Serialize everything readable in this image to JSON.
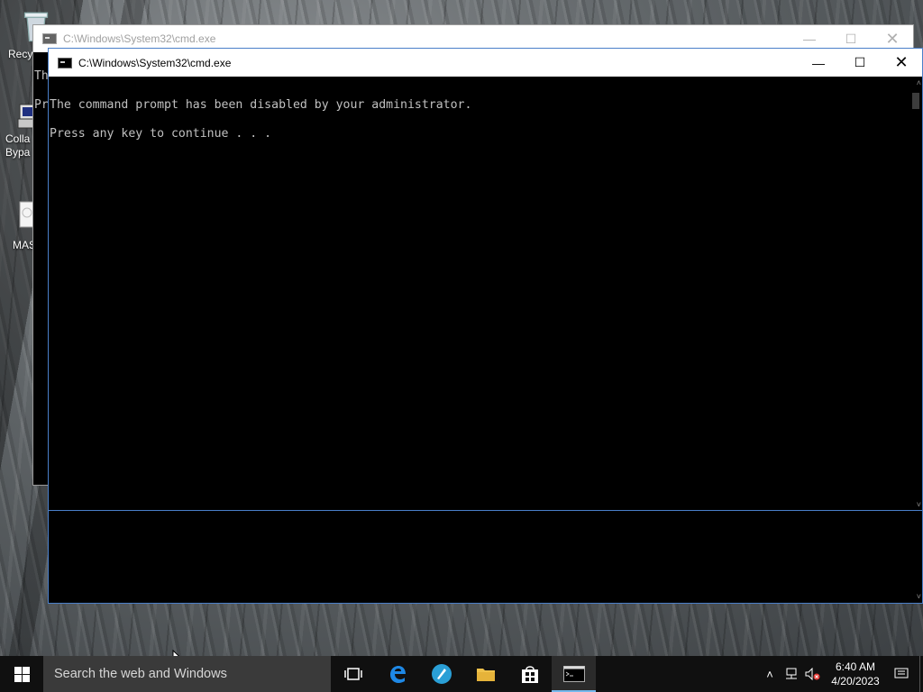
{
  "desktop": {
    "icons": [
      {
        "label": "Recy",
        "icon": "recycle-bin-icon"
      },
      {
        "label": "Colla Bypa",
        "icon": "app-shortcut-icon"
      },
      {
        "label": "MAS",
        "icon": "document-icon"
      }
    ]
  },
  "back_window": {
    "title": "C:\\Windows\\System32\\cmd.exe",
    "partial_lines": [
      "Th",
      "Pr"
    ]
  },
  "front_window": {
    "title": "C:\\Windows\\System32\\cmd.exe",
    "console_lines": [
      "The command prompt has been disabled by your administrator.",
      "Press any key to continue . . ."
    ],
    "controls": {
      "minimize": "minimize-icon",
      "maximize": "maximize-icon",
      "close": "close-icon"
    }
  },
  "taskbar": {
    "search_placeholder": "Search the web and Windows",
    "pinned": [
      "task-view-icon",
      "edge-icon",
      "app-icon",
      "file-explorer-icon",
      "store-icon",
      "cmd-icon"
    ],
    "tray": {
      "time": "6:40 AM",
      "date": "4/20/2023",
      "icons": [
        "chevron-up-icon",
        "network-icon",
        "volume-muted-icon",
        "notifications-icon"
      ]
    }
  },
  "colors": {
    "console_bg": "#000000",
    "console_fg": "#c0c0c0",
    "accent": "#4a7fc9",
    "taskbar": "#101010"
  }
}
